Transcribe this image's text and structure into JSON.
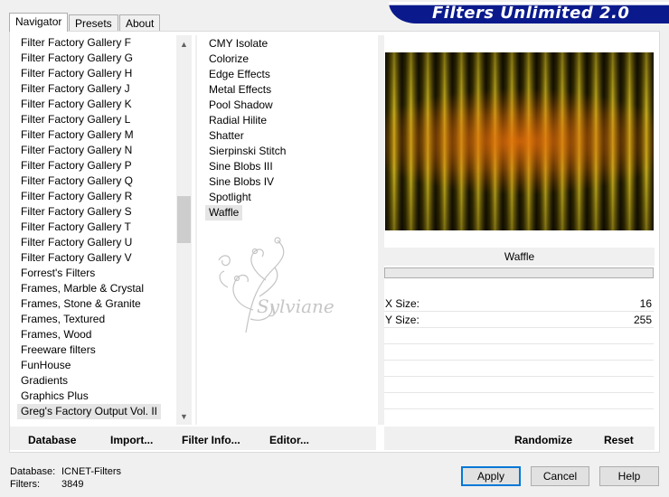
{
  "tabs": [
    "Navigator",
    "Presets",
    "About"
  ],
  "title": "Filters Unlimited 2.0",
  "categories": [
    "Filter Factory Gallery F",
    "Filter Factory Gallery G",
    "Filter Factory Gallery H",
    "Filter Factory Gallery J",
    "Filter Factory Gallery K",
    "Filter Factory Gallery L",
    "Filter Factory Gallery M",
    "Filter Factory Gallery N",
    "Filter Factory Gallery P",
    "Filter Factory Gallery Q",
    "Filter Factory Gallery R",
    "Filter Factory Gallery S",
    "Filter Factory Gallery T",
    "Filter Factory Gallery U",
    "Filter Factory Gallery V",
    "Forrest's Filters",
    "Frames, Marble & Crystal",
    "Frames, Stone & Granite",
    "Frames, Textured",
    "Frames, Wood",
    "Freeware filters",
    "FunHouse",
    "Gradients",
    "Graphics Plus",
    "Greg's Factory Output Vol. II"
  ],
  "selected_category": "Greg's Factory Output Vol. II",
  "filters": [
    "CMY Isolate",
    "Colorize",
    "Edge Effects",
    "Metal Effects",
    "Pool Shadow",
    "Radial Hilite",
    "Shatter",
    "Sierpinski Stitch",
    "Sine Blobs III",
    "Sine Blobs IV",
    "Spotlight",
    "Waffle"
  ],
  "selected_filter": "Waffle",
  "watermark_text": "Sylviane",
  "parameters": {
    "title": "Waffle",
    "rows": [
      {
        "label": "X Size:",
        "value": "16"
      },
      {
        "label": "Y Size:",
        "value": "255"
      }
    ]
  },
  "links": [
    "Database",
    "Import...",
    "Filter Info...",
    "Editor..."
  ],
  "right_links": [
    "Randomize",
    "Reset"
  ],
  "status": {
    "database_label": "Database:",
    "database_value": "ICNET-Filters",
    "filters_label": "Filters:",
    "filters_value": "3849"
  },
  "buttons": {
    "apply": "Apply",
    "cancel": "Cancel",
    "help": "Help"
  },
  "colors": {
    "banner": "#0a1a8c",
    "preview_glow": "#e66e0a",
    "default_button_border": "#0078d7"
  }
}
